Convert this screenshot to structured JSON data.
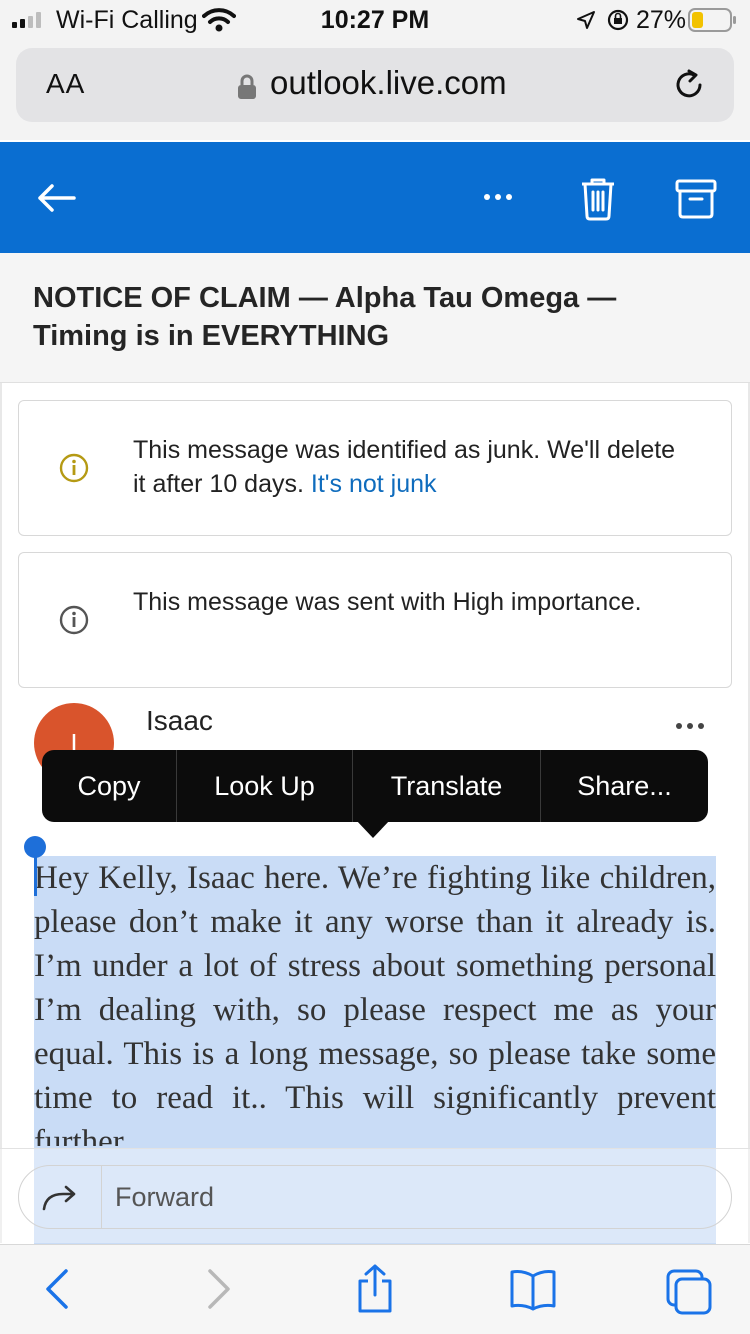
{
  "status_bar": {
    "carrier": "Wi-Fi Calling",
    "time": "10:27 PM",
    "battery": "27%",
    "icons": [
      "signal-icon",
      "wifi-icon",
      "location-icon",
      "orientation-lock-icon",
      "battery-icon"
    ]
  },
  "browser": {
    "text_size_button": "AA",
    "url": "outlook.live.com",
    "icons": [
      "lock-icon",
      "reload-icon"
    ]
  },
  "mail_header": {
    "icons": [
      "back-arrow-icon",
      "more-icon",
      "delete-icon",
      "archive-icon"
    ],
    "accent_color": "#0a6ed1"
  },
  "message": {
    "subject": "NOTICE OF CLAIM — Alpha Tau Omega — Timing is in EVERYTHING",
    "junk_notice": {
      "text": "This message was identified as junk. We'll delete it after 10 days. ",
      "link": "It's not junk",
      "icon": "info-icon"
    },
    "importance_notice": {
      "text": "This message was sent with High importance.",
      "icon": "info-icon"
    },
    "sender": {
      "name": "Isaac",
      "initial": "I",
      "avatar_color": "#d9542c"
    },
    "body": "Hey Kelly, Isaac here. We’re fighting like children, please don’t make it any worse than it already is. I’m under a lot of stress about something personal I’m dealing with, so please respect me as your equal. This is a long message, so please take some time to read it.. This will significantly prevent further"
  },
  "context_menu": {
    "items": [
      "Copy",
      "Look Up",
      "Translate",
      "Share..."
    ]
  },
  "reply_bar": {
    "forward_label": "Forward",
    "icon": "forward-icon"
  },
  "safari_toolbar": {
    "icons": [
      "back-icon",
      "forward-nav-icon",
      "share-icon",
      "bookmarks-icon",
      "tabs-icon"
    ]
  }
}
